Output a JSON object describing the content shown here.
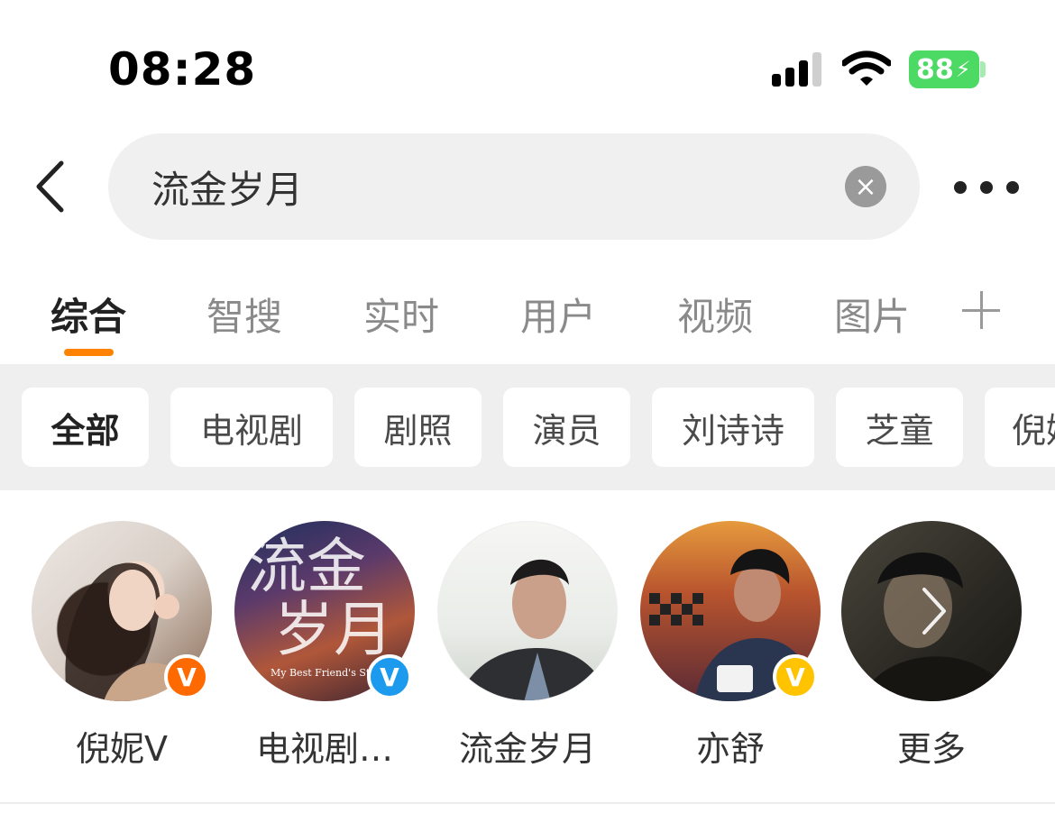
{
  "status_bar": {
    "time": "08:28",
    "battery": "88"
  },
  "search": {
    "query": "流金岁月",
    "placeholder": ""
  },
  "tabs": [
    {
      "label": "综合",
      "active": true
    },
    {
      "label": "智搜"
    },
    {
      "label": "实时"
    },
    {
      "label": "用户"
    },
    {
      "label": "视频"
    },
    {
      "label": "图片"
    }
  ],
  "filters": [
    {
      "label": "全部",
      "active": true
    },
    {
      "label": "电视剧"
    },
    {
      "label": "剧照"
    },
    {
      "label": "演员"
    },
    {
      "label": "刘诗诗"
    },
    {
      "label": "芝童"
    },
    {
      "label": "倪妮"
    }
  ],
  "avatars": [
    {
      "label": "倪妮V",
      "badge": "V",
      "badge_color": "#ff6a00"
    },
    {
      "label": "电视剧…",
      "badge": "V",
      "badge_color": "#1b9aee",
      "poster_title_1": "流金",
      "poster_title_2": "岁月",
      "poster_subtitle": "My Best Friend's Story"
    },
    {
      "label": "流金岁月"
    },
    {
      "label": "亦舒",
      "badge": "V",
      "badge_color": "#ffc300"
    },
    {
      "label": "更多"
    }
  ],
  "colors": {
    "accent": "#ff8200",
    "battery": "#4cd964"
  },
  "icons": [
    "back-arrow-icon",
    "clear-icon",
    "more-dots-icon",
    "plus-icon",
    "chevron-right-icon",
    "signal-icon",
    "wifi-icon"
  ]
}
